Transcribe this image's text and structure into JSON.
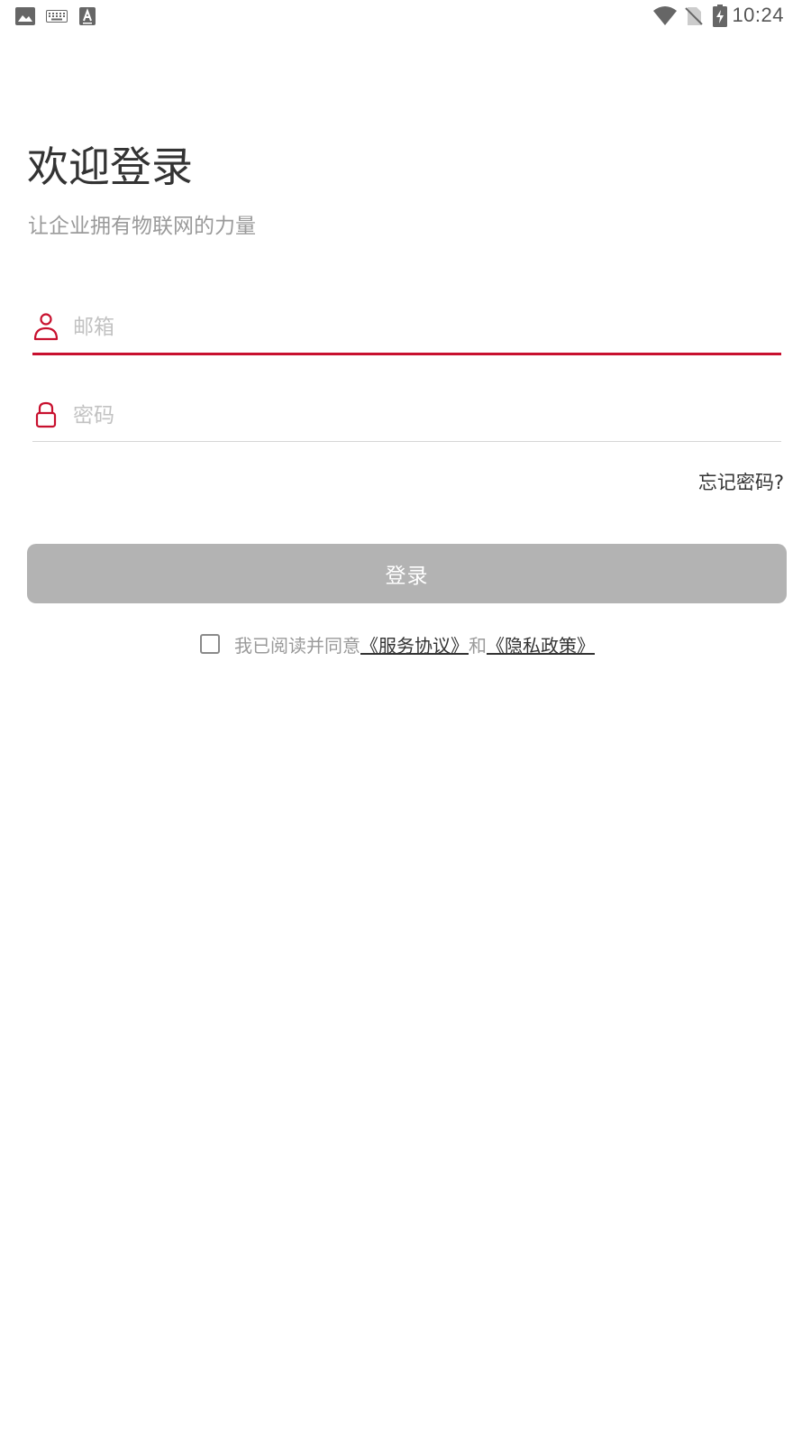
{
  "status_bar": {
    "time": "10:24",
    "left_icons": [
      "image-icon",
      "keyboard-icon",
      "text-a-icon"
    ],
    "right_icons": [
      "wifi-icon",
      "no-sim-icon",
      "battery-charging-icon"
    ]
  },
  "header": {
    "title": "欢迎登录",
    "subtitle": "让企业拥有物联网的力量"
  },
  "form": {
    "email": {
      "placeholder": "邮箱",
      "value": ""
    },
    "password": {
      "placeholder": "密码",
      "value": ""
    },
    "forgot_label": "忘记密码?",
    "submit_label": "登录"
  },
  "agreement": {
    "checked": false,
    "prefix": "我已阅读并同意",
    "terms_link": "《服务协议》",
    "connector": "和",
    "privacy_link": "《隐私政策》"
  },
  "colors": {
    "accent": "#c8102e",
    "button_disabled": "#b3b3b3",
    "title": "#333333",
    "subtitle": "#9a9a9a"
  }
}
